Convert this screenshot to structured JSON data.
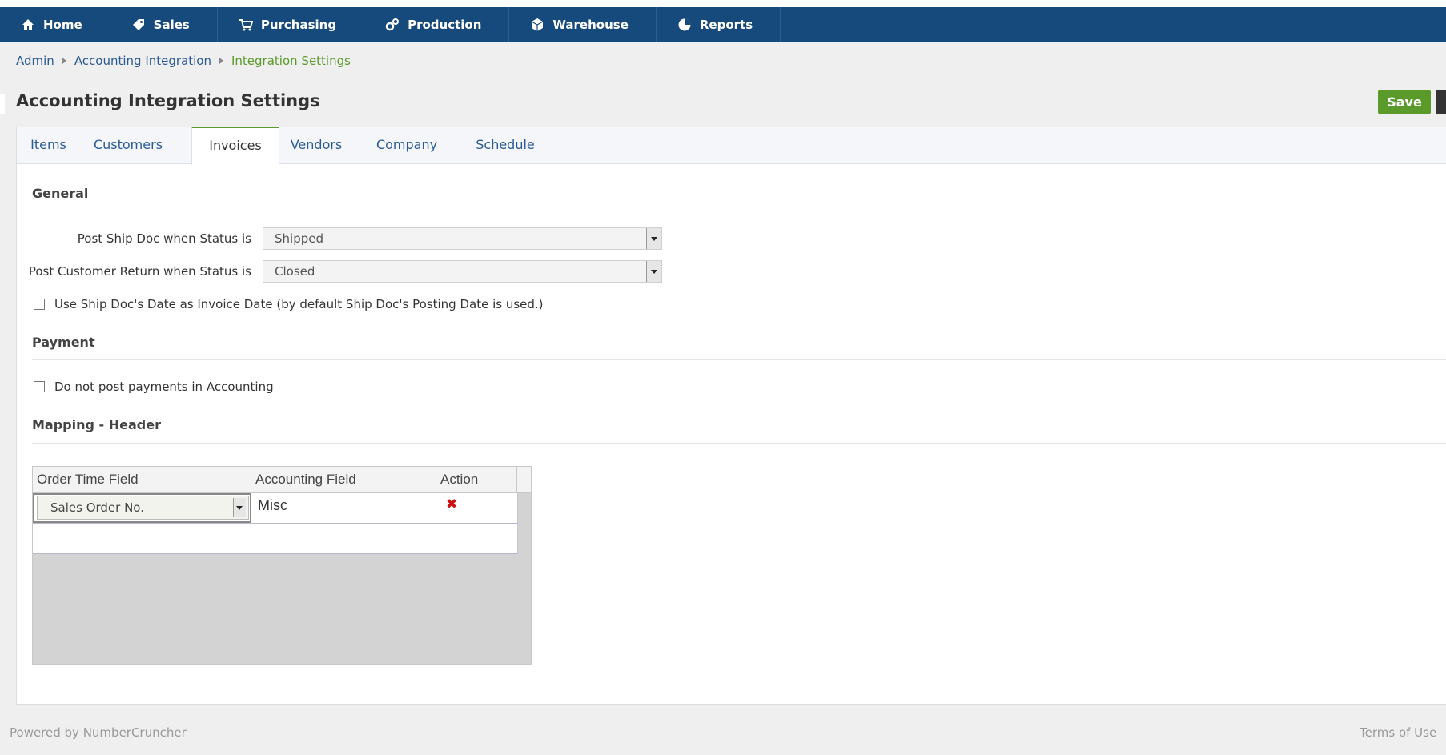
{
  "nav": {
    "items": [
      {
        "label": "Home",
        "icon": "home-icon"
      },
      {
        "label": "Sales",
        "icon": "tag-icon"
      },
      {
        "label": "Purchasing",
        "icon": "cart-icon"
      },
      {
        "label": "Production",
        "icon": "gears-icon"
      },
      {
        "label": "Warehouse",
        "icon": "box-icon"
      },
      {
        "label": "Reports",
        "icon": "pie-chart-icon"
      }
    ]
  },
  "breadcrumb": [
    "Admin",
    "Accounting Integration",
    "Integration Settings"
  ],
  "page": {
    "title": "Accounting Integration Settings",
    "save_label": "Save"
  },
  "tabs": [
    {
      "label": "Items"
    },
    {
      "label": "Customers"
    },
    {
      "label": "Invoices",
      "active": true
    },
    {
      "label": "Vendors"
    },
    {
      "label": "Company"
    },
    {
      "label": "Schedule"
    }
  ],
  "general": {
    "title": "General",
    "ship_doc_label": "Post Ship Doc when Status is",
    "ship_doc_value": "Shipped",
    "customer_return_label": "Post Customer Return when Status is",
    "customer_return_value": "Closed",
    "ship_date_checkbox_label": "Use Ship Doc's Date as Invoice Date (by default Ship Doc's Posting Date is used.)",
    "ship_date_checked": false
  },
  "payment": {
    "title": "Payment",
    "no_post_label": "Do not post payments in Accounting",
    "no_post_checked": false
  },
  "mapping": {
    "title": "Mapping - Header",
    "columns": [
      "Order Time Field",
      "Accounting Field",
      "Action"
    ],
    "rows": [
      {
        "order_time_field": "Sales Order No.",
        "accounting_field": "Misc"
      }
    ]
  },
  "colors": {
    "nav_bg": "#16497c",
    "accent_green": "#5a9a2b",
    "link_blue": "#2a5a94",
    "delete_red": "#cc1111"
  },
  "footer": {
    "powered_by": "Powered by NumberCruncher",
    "terms": "Terms of Use"
  }
}
